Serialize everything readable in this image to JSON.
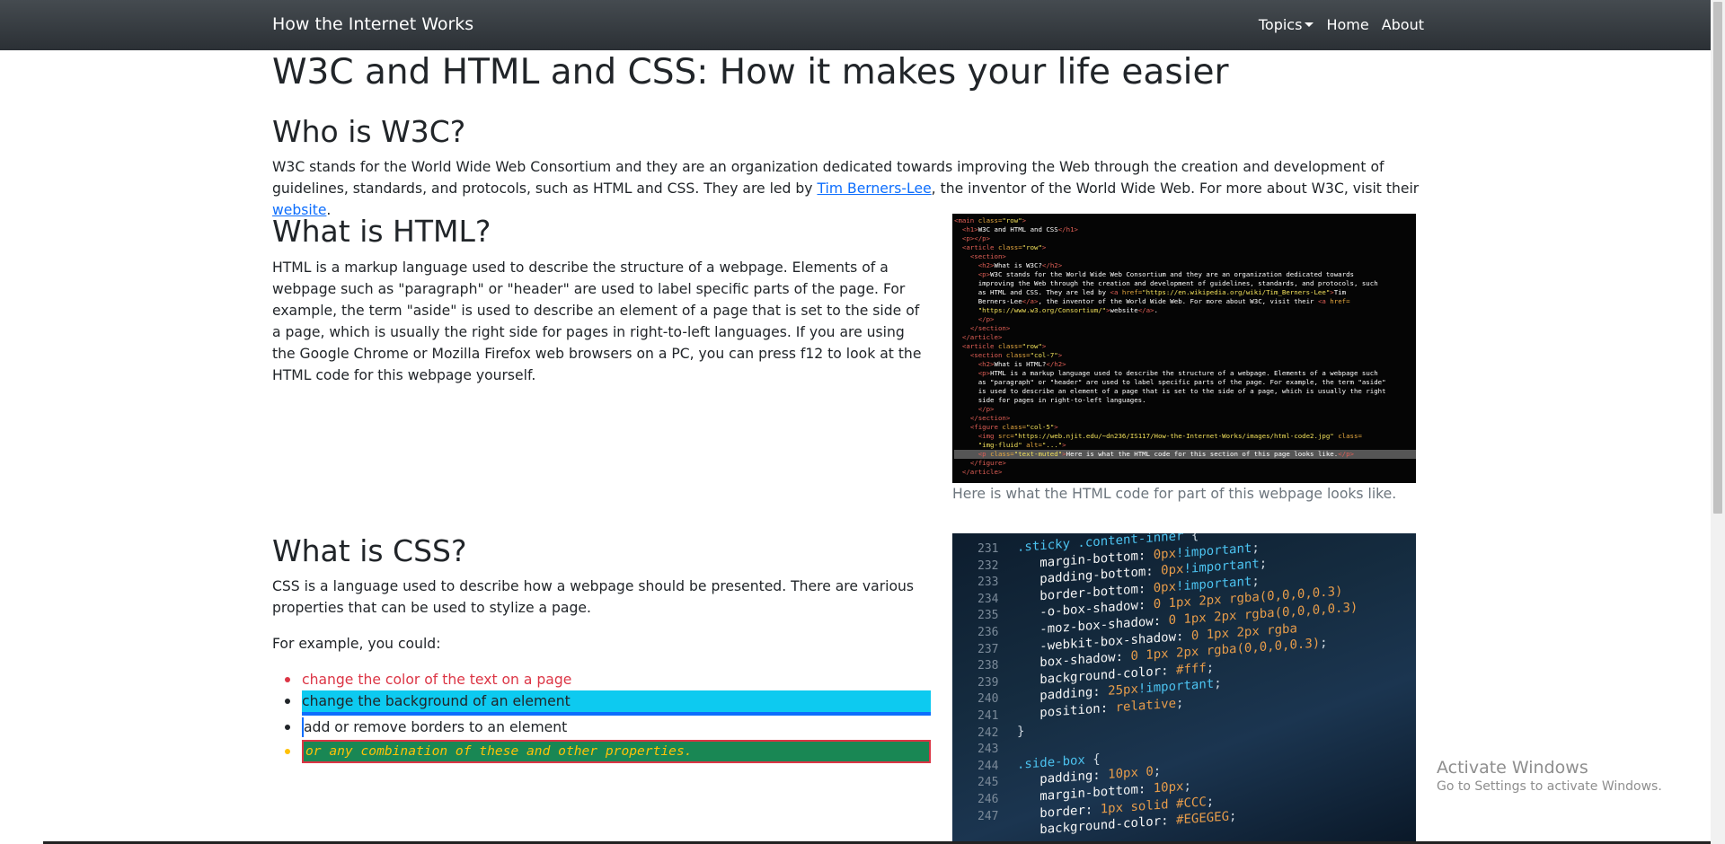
{
  "navbar": {
    "brand": "How the Internet Works",
    "links": {
      "topics": "Topics",
      "home": "Home",
      "about": "About"
    }
  },
  "main": {
    "title": "W3C and HTML and CSS: How it makes your life easier",
    "who": {
      "heading": "Who is W3C?",
      "text_before_link1": "W3C stands for the World Wide Web Consortium and they are an organization dedicated towards improving the Web through the creation and development of guidelines, standards, and protocols, such as HTML and CSS. They are led by ",
      "link1": "Tim Berners-Lee",
      "text_between": ", the inventor of the World Wide Web. For more about W3C, visit their ",
      "link2": "website",
      "text_after": "."
    },
    "html": {
      "heading": "What is HTML?",
      "text": "HTML is a markup language used to describe the structure of a webpage. Elements of a webpage such as \"paragraph\" or \"header\" are used to label specific parts of the page. For example, the term \"aside\" is used to describe an element of a page that is set to the side of a page, which is usually the right side for pages in right-to-left languages. If you are using the Google Chrome or Mozilla Firefox web browsers on a PC, you can press f12 to look at the HTML code for this webpage yourself.",
      "caption": "Here is what the HTML code for part of this webpage looks like."
    },
    "css": {
      "heading": "What is CSS?",
      "text": "CSS is a language used to describe how a webpage should be presented. There are various properties that can be used to stylize a page.",
      "example_intro": "For example, you could:",
      "list": [
        "change the color of the text on a page",
        "change the background of an element",
        "add or remove borders to an element",
        "or any combination of these and other properties."
      ]
    }
  },
  "watermark": {
    "title": "Activate Windows",
    "subtitle": "Go to Settings to activate Windows."
  },
  "colors": {
    "navbar": "#343a40",
    "red_text": "#dc3545",
    "info_bg": "#0dcaf0",
    "primary": "#0d6efd",
    "success_bg": "#198754",
    "warning_text": "#ffc107"
  }
}
